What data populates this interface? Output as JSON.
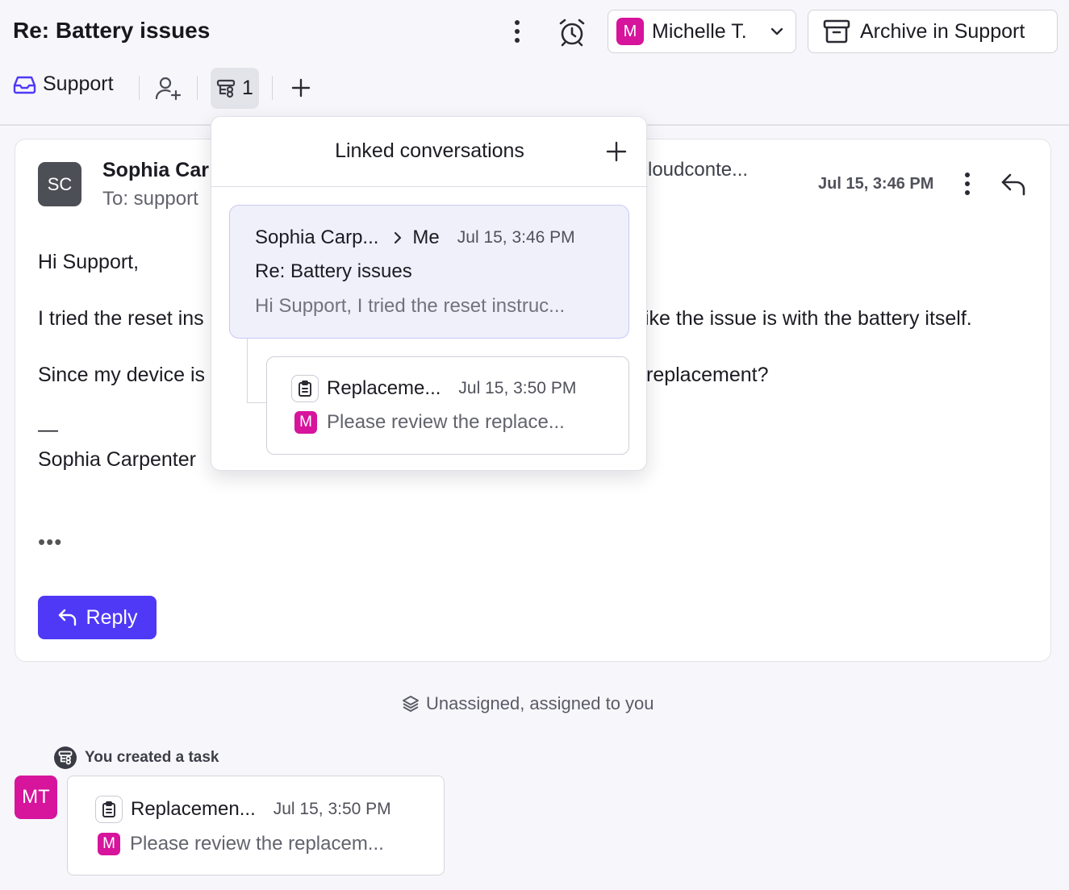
{
  "header": {
    "title": "Re: Battery issues",
    "assignee": {
      "initial": "M",
      "name": "Michelle T."
    },
    "archive_label": "Archive in Support"
  },
  "toolbar": {
    "inbox_label": "Support",
    "linked_count": "1"
  },
  "message": {
    "avatar_initials": "SC",
    "sender": "Sophia Car",
    "to": "To: support",
    "from_email": "cloudconte...",
    "time": "Jul 15, 3:46 PM",
    "body": [
      "Hi Support,",
      "I tried the reset ins",
      "ike the issue is with the battery itself.",
      "Since my device is",
      "replacement?",
      "—",
      "Sophia Carpenter"
    ],
    "ellipsis": "•••",
    "reply_label": "Reply"
  },
  "activity": {
    "status": "Unassigned, assigned to you",
    "created_label": "You created a task",
    "avatar_initials": "MT",
    "task": {
      "name": "Replacemen...",
      "time": "Jul 15, 3:50 PM",
      "initial": "M",
      "preview": "Please review the replacem..."
    }
  },
  "popover": {
    "title": "Linked conversations",
    "conversation": {
      "from": "Sophia Carp...",
      "to": "Me",
      "time": "Jul 15, 3:46 PM",
      "subject": "Re: Battery issues",
      "preview": "Hi Support, I tried the reset instruc..."
    },
    "task": {
      "name": "Replaceme...",
      "time": "Jul 15, 3:50 PM",
      "initial": "M",
      "preview": "Please review the replace..."
    }
  },
  "colors": {
    "primary": "#4f39f6",
    "avatar_magenta": "#d6149c",
    "avatar_gray": "#4d4f57",
    "linked_highlight": "#f0f0fb"
  },
  "icons": {
    "header": [
      "kebab-icon",
      "alarm-clock-icon",
      "chevron-down-icon",
      "archive-box-icon"
    ],
    "toolbar": [
      "inbox-tray-icon",
      "add-person-icon",
      "linked-conversations-icon",
      "plus-icon"
    ],
    "message": [
      "kebab-icon",
      "reply-arrow-icon"
    ],
    "activity": [
      "layers-icon",
      "linked-conversations-icon",
      "clipboard-icon"
    ]
  }
}
